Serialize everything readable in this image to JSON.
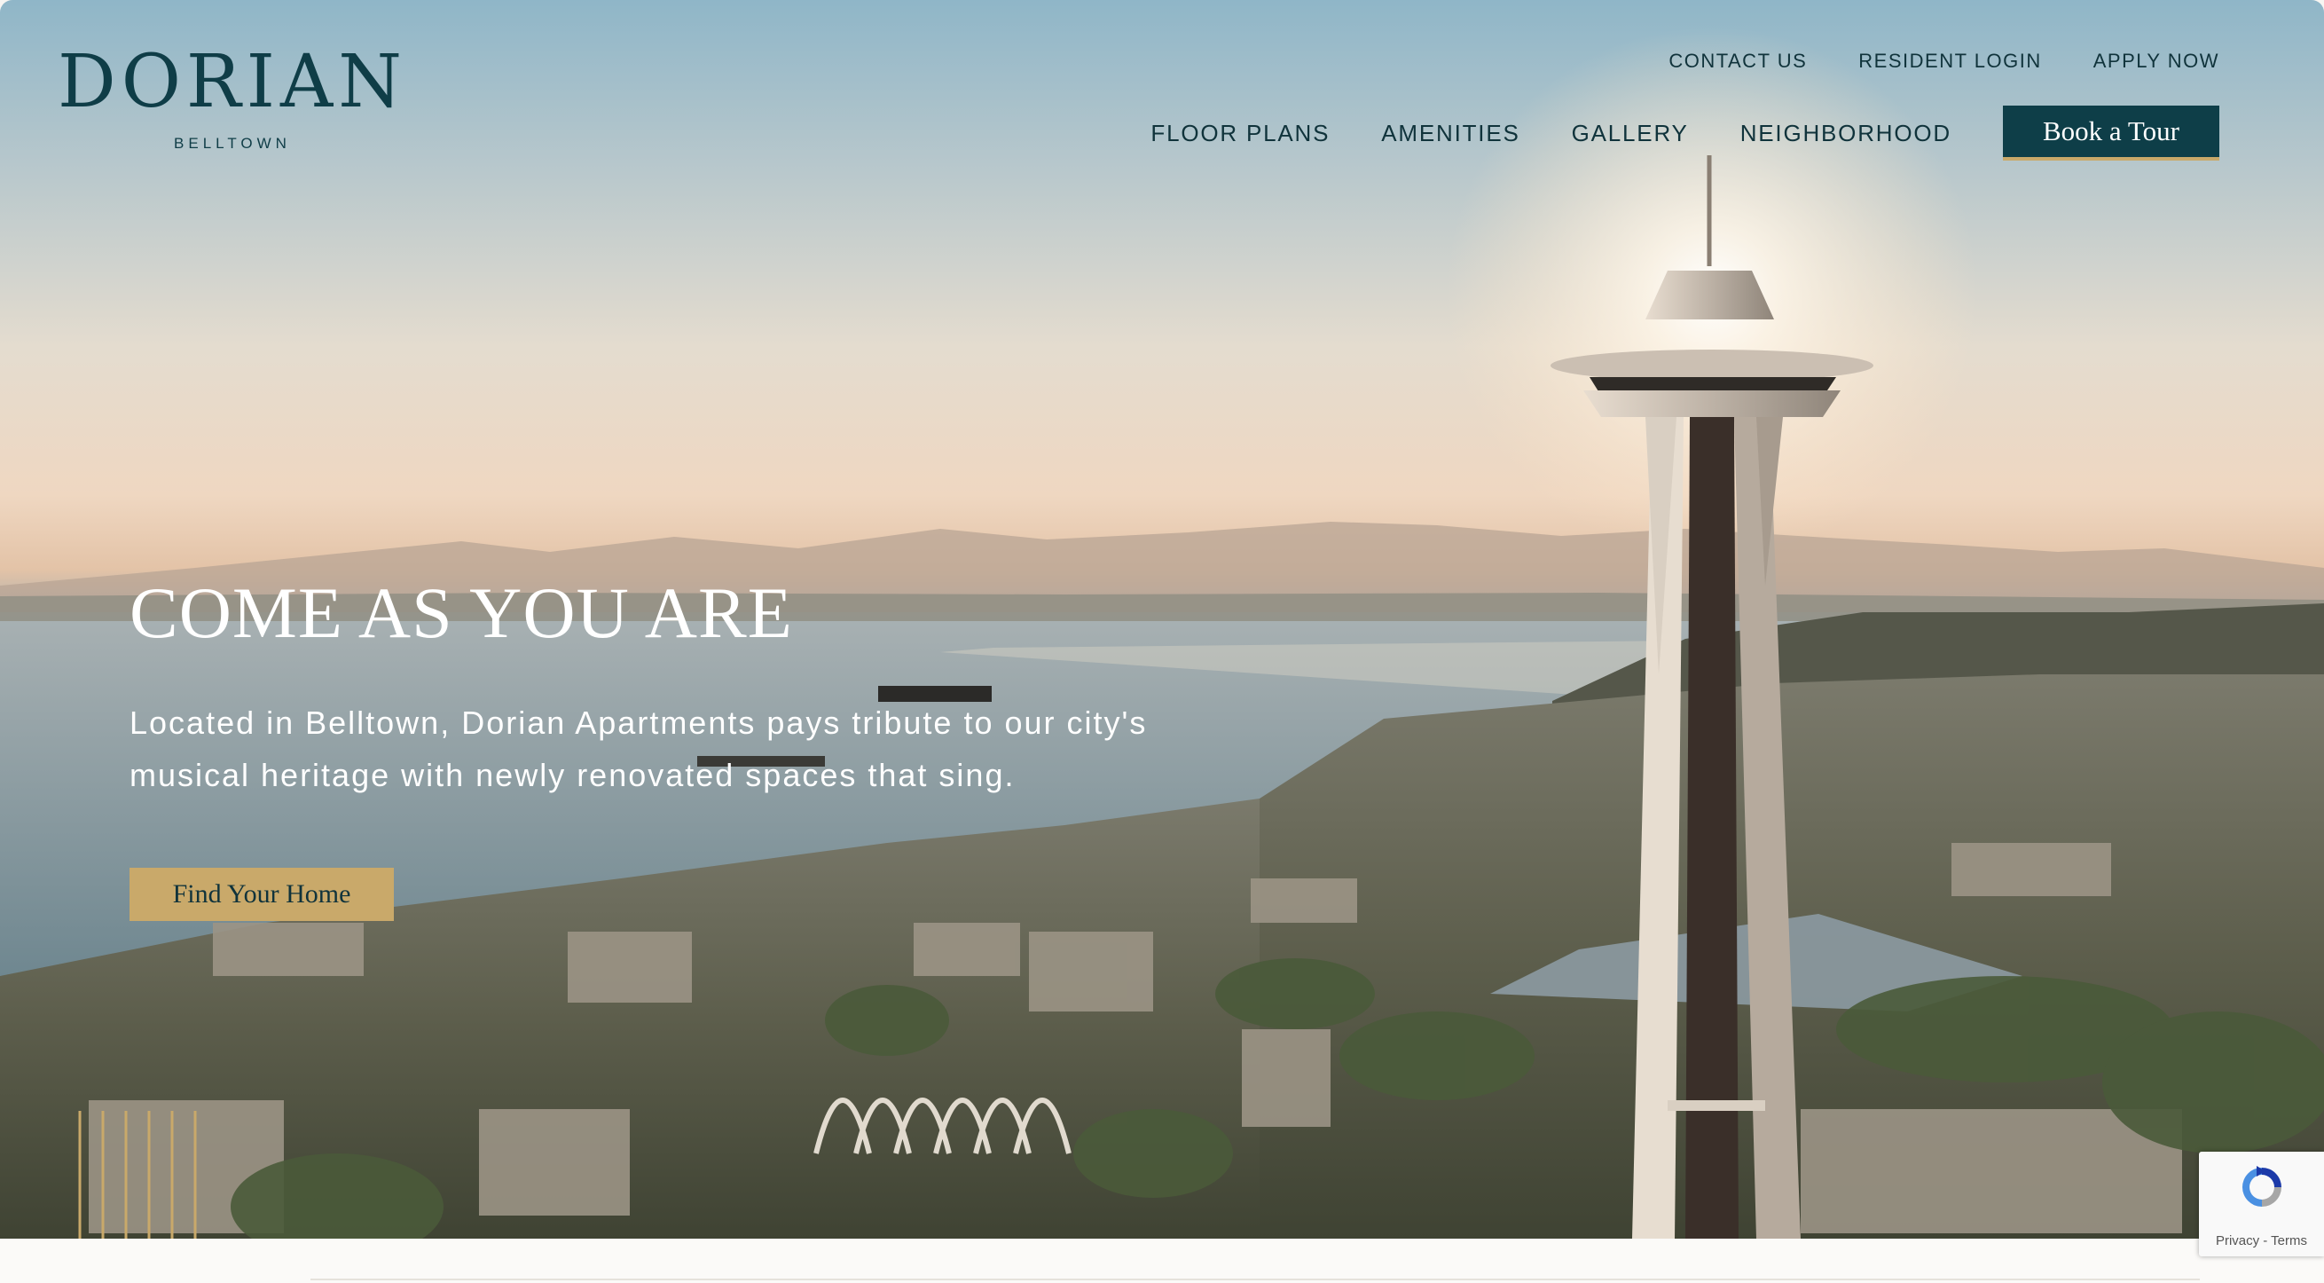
{
  "brand": {
    "name": "DORIAN",
    "location": "BELLTOWN"
  },
  "utility_nav": [
    {
      "label": "CONTACT US"
    },
    {
      "label": "RESIDENT LOGIN"
    },
    {
      "label": "APPLY NOW"
    }
  ],
  "main_nav": [
    {
      "label": "FLOOR PLANS"
    },
    {
      "label": "AMENITIES"
    },
    {
      "label": "GALLERY"
    },
    {
      "label": "NEIGHBORHOOD"
    }
  ],
  "tour_button": {
    "label": "Book a Tour"
  },
  "hero": {
    "headline": "COME AS YOU ARE",
    "subcopy": "Located in Belltown, Dorian Apartments pays tribute to our city's musical heritage with newly renovated spaces that sing.",
    "cta_label": "Find Your Home",
    "image": "seattle-space-needle-aerial-photo"
  },
  "recaptcha": {
    "text": "Privacy - Terms",
    "icon": "recaptcha-icon"
  },
  "colors": {
    "brand_teal": "#0e3e48",
    "accent_gold": "#c9a96a",
    "text_dark": "#10333b"
  }
}
